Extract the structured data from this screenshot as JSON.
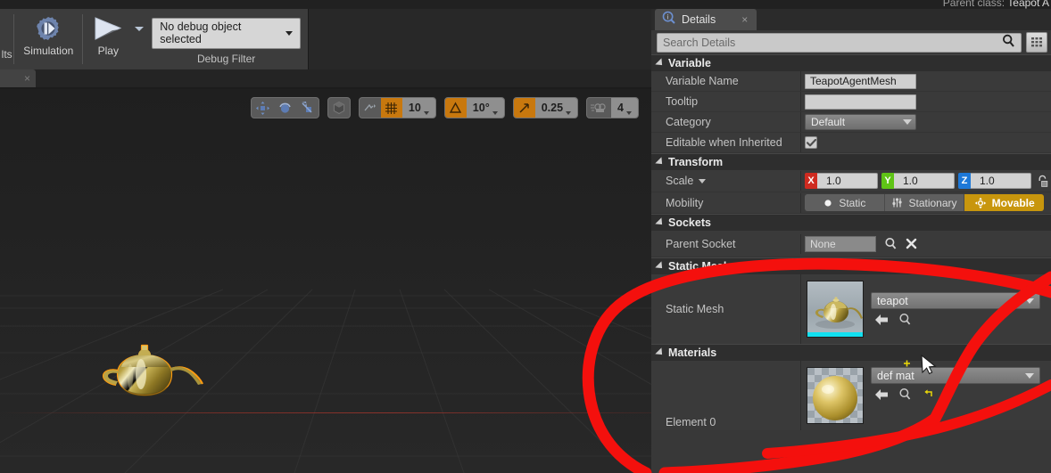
{
  "window": {
    "parent_class_label": "Parent class:",
    "parent_class_value": "Teapot A"
  },
  "toolbar": {
    "results_tab_clipped": "lts",
    "simulation_label": "Simulation",
    "play_label": "Play",
    "debug_object_value": "No debug object selected",
    "debug_filter_label": "Debug Filter"
  },
  "viewport": {
    "snap_translate_value": "10",
    "snap_rotate_value": "10°",
    "snap_scale_value": "0.25",
    "camera_speed_value": "4",
    "selection_outline_color": "#ff9b10",
    "grid_axis_color": "#8a3028"
  },
  "details": {
    "tab_title": "Details",
    "close_label": "×",
    "search_placeholder": "Search Details",
    "search_value": "",
    "sections": {
      "variable": {
        "title": "Variable",
        "rows": [
          {
            "label": "Variable Name",
            "value": "TeapotAgentMesh"
          },
          {
            "label": "Tooltip",
            "value": ""
          },
          {
            "label": "Category",
            "value": "Default"
          },
          {
            "label": "Editable when Inherited",
            "value": "checked"
          }
        ]
      },
      "transform": {
        "title": "Transform",
        "scale_label": "Scale",
        "scale_x": "1.0",
        "scale_y": "1.0",
        "scale_z": "1.0",
        "axis_x_tag": "X",
        "axis_y_tag": "Y",
        "axis_z_tag": "Z",
        "mobility_label": "Mobility",
        "mobility_options": [
          "Static",
          "Stationary",
          "Movable"
        ],
        "mobility_selected": "Movable",
        "mobility_selected_color": "#c8960d"
      },
      "sockets": {
        "title": "Sockets",
        "parent_socket_label": "Parent Socket",
        "parent_socket_value": "None"
      },
      "static_mesh": {
        "title": "Static Mesh",
        "row_label": "Static Mesh",
        "asset_value": "teapot"
      },
      "materials": {
        "title": "Materials",
        "row_label": "Element 0",
        "asset_value": "def     mat"
      }
    }
  },
  "annotation": {
    "color": "#f4100d",
    "shape": "hand-drawn-ellipse"
  }
}
